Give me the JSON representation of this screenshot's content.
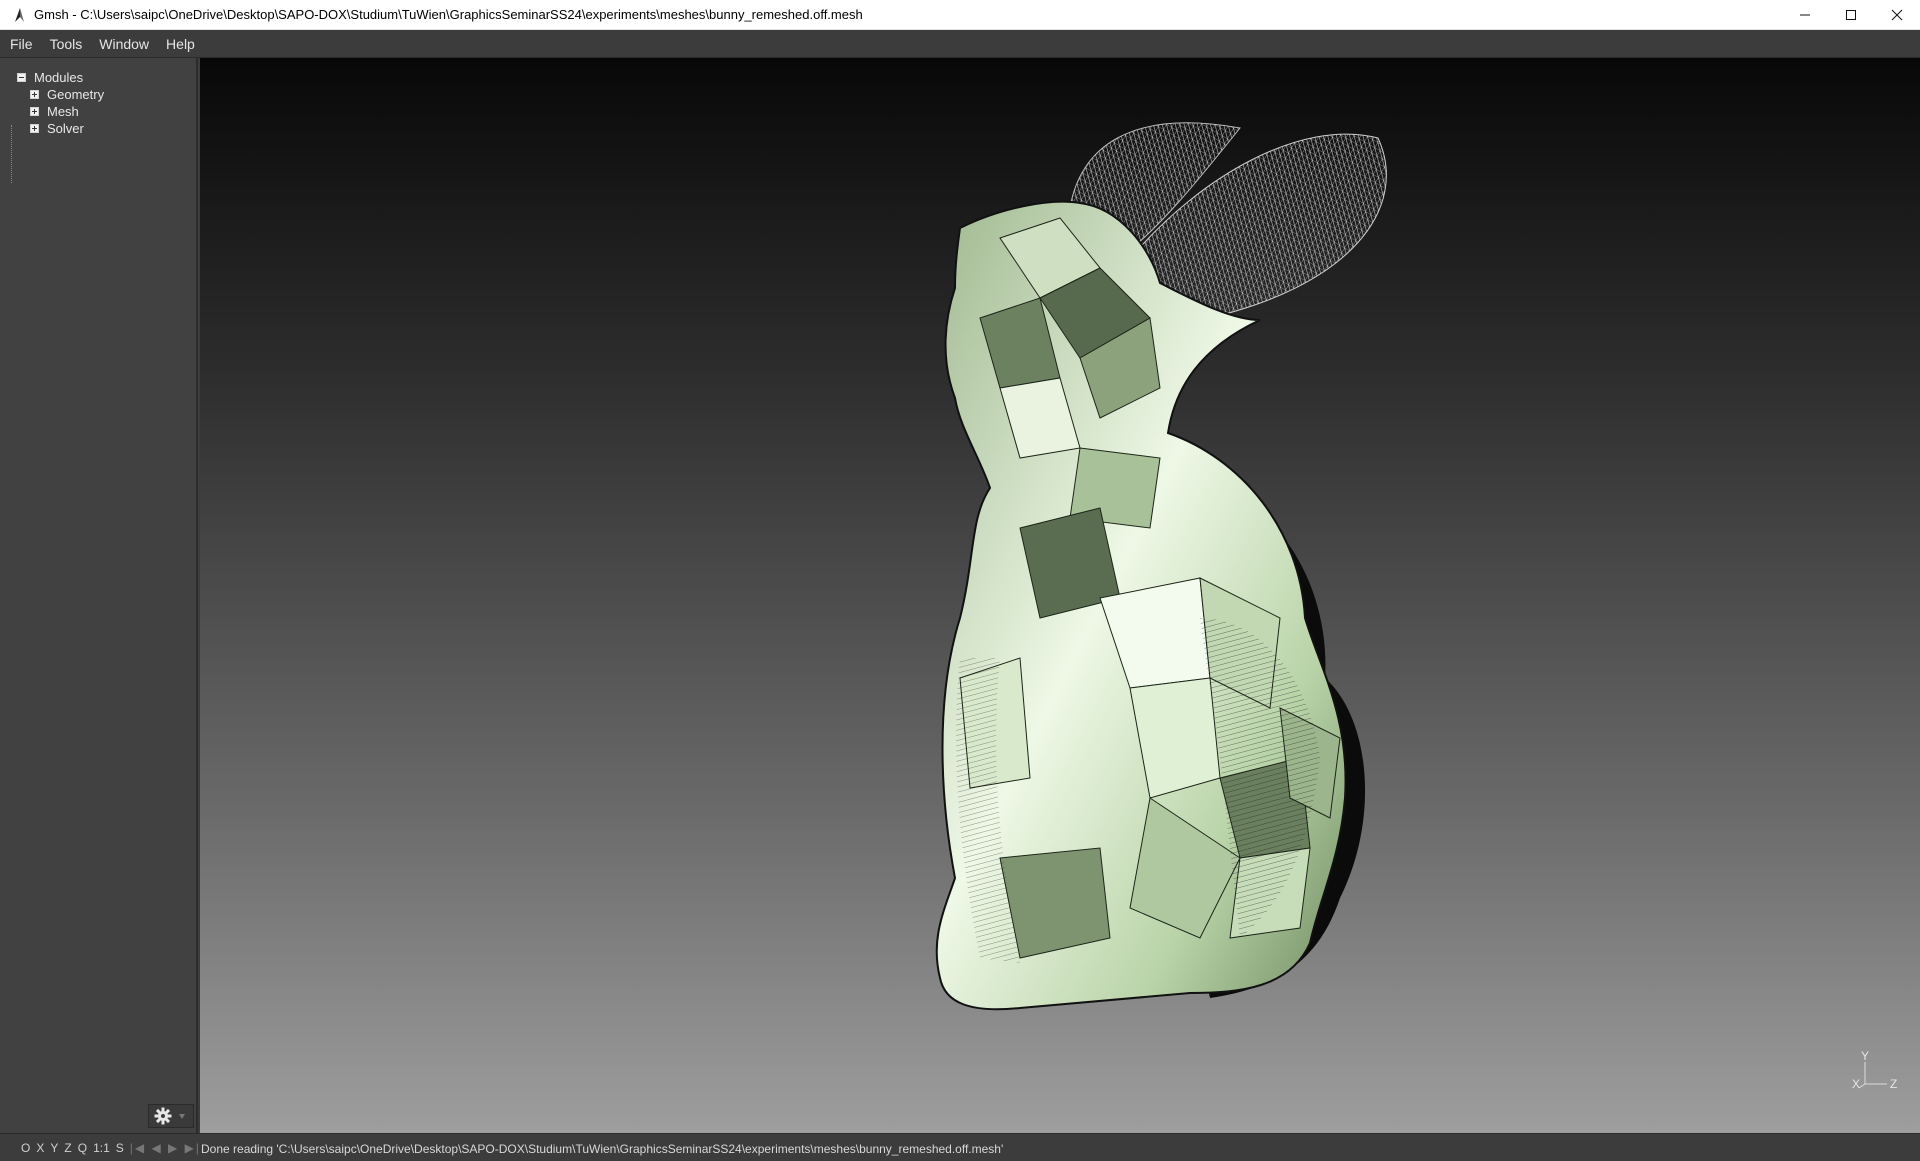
{
  "window": {
    "title": "Gmsh - C:\\Users\\saipc\\OneDrive\\Desktop\\SAPO-DOX\\Studium\\TuWien\\GraphicsSeminarSS24\\experiments\\meshes\\bunny_remeshed.off.mesh",
    "controls": [
      "minimize-icon",
      "maximize-icon",
      "close-icon"
    ]
  },
  "menu": {
    "file": "File",
    "tools": "Tools",
    "window": "Window",
    "help": "Help"
  },
  "tree": {
    "root": "Modules",
    "items": [
      "Geometry",
      "Mesh",
      "Solver"
    ]
  },
  "viewport": {
    "object": "bunny_remeshed.off.mesh",
    "mesh_color": "#cfe6c2",
    "background_top": "#080808",
    "background_bottom": "#9e9e9e",
    "axes": {
      "x": "X",
      "y": "Y",
      "z": "Z"
    }
  },
  "statusbar": {
    "quick_buttons": [
      "O",
      "X",
      "Y",
      "Z",
      "Q",
      "1:1",
      "S"
    ],
    "message": "Done reading 'C:\\Users\\saipc\\OneDrive\\Desktop\\SAPO-DOX\\Studium\\TuWien\\GraphicsSeminarSS24\\experiments\\meshes\\bunny_remeshed.off.mesh'"
  },
  "icons": {
    "app": "gmsh-logo-icon",
    "options": "gear-icon"
  }
}
